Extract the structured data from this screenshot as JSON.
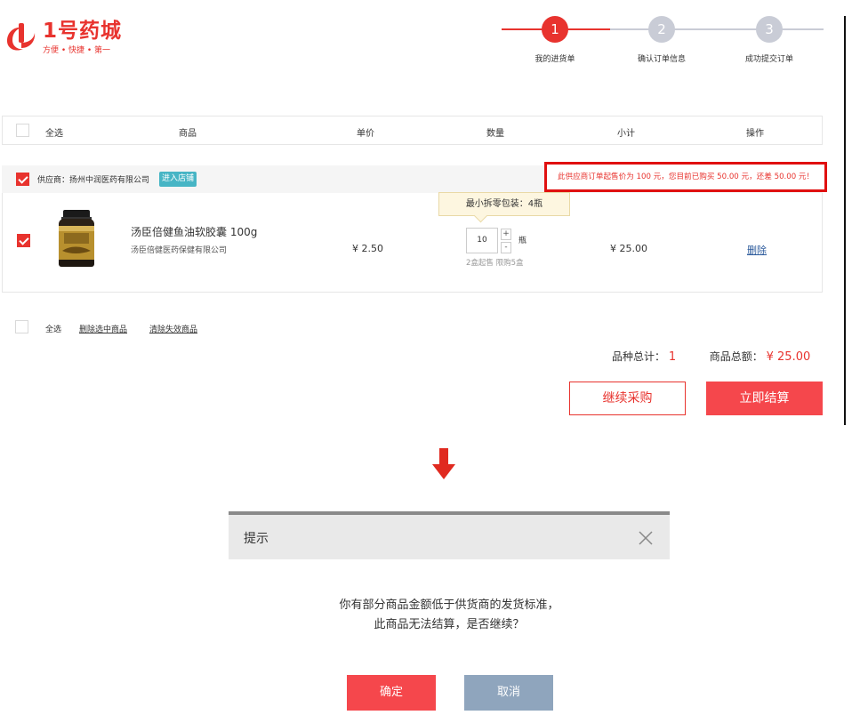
{
  "logo": {
    "name": "1号药城",
    "slogan": "方便 • 快捷 • 第一",
    "color": "#e8332e"
  },
  "steps": [
    {
      "num": "1",
      "label": "我的进货单",
      "active": true
    },
    {
      "num": "2",
      "label": "确认订单信息",
      "active": false
    },
    {
      "num": "3",
      "label": "成功提交订单",
      "active": false
    }
  ],
  "colors": {
    "accent": "#e8332e",
    "step_inactive": "#c9ccd6",
    "cancel": "#8fa5bd",
    "shop_badge": "#47b5c5"
  },
  "table_header": {
    "select_all": "全选",
    "columns": [
      "商品",
      "单价",
      "数量",
      "小计",
      "操作"
    ]
  },
  "supplier": {
    "name": "供应商：扬州中润医药有限公司",
    "shop_button": "进入店铺",
    "warning": "此供应商订单起售价为 100 元，您目前已购买 50.00 元，还差 50.00 元！"
  },
  "product": {
    "name": "汤臣倍健鱼油软胶囊 100g",
    "maker": "汤臣倍健医药保健有限公司",
    "price": "¥ 2.50",
    "quantity": "10",
    "unit": "瓶",
    "plus": "+",
    "minus": "-",
    "min_pack_tip": "最小拆零包装：4瓶",
    "limit_note": "2盒起售 限购5盒",
    "subtotal": "¥ 25.00",
    "delete": "删除"
  },
  "footer": {
    "select_all": "全选",
    "delete_selected": "删除选中商品",
    "clear_invalid": "清除失效商品",
    "kinds_label": "品种总计：",
    "kinds_value": "1",
    "total_label": "商品总额：",
    "total_value": "¥ 25.00",
    "continue_button": "继续采购",
    "checkout_button": "立即结算"
  },
  "dialog": {
    "title": "提示",
    "message_line1": "你有部分商品金额低于供货商的发货标准，",
    "message_line2": "此商品无法结算，是否继续？",
    "ok_button": "确定",
    "cancel_button": "取消"
  }
}
